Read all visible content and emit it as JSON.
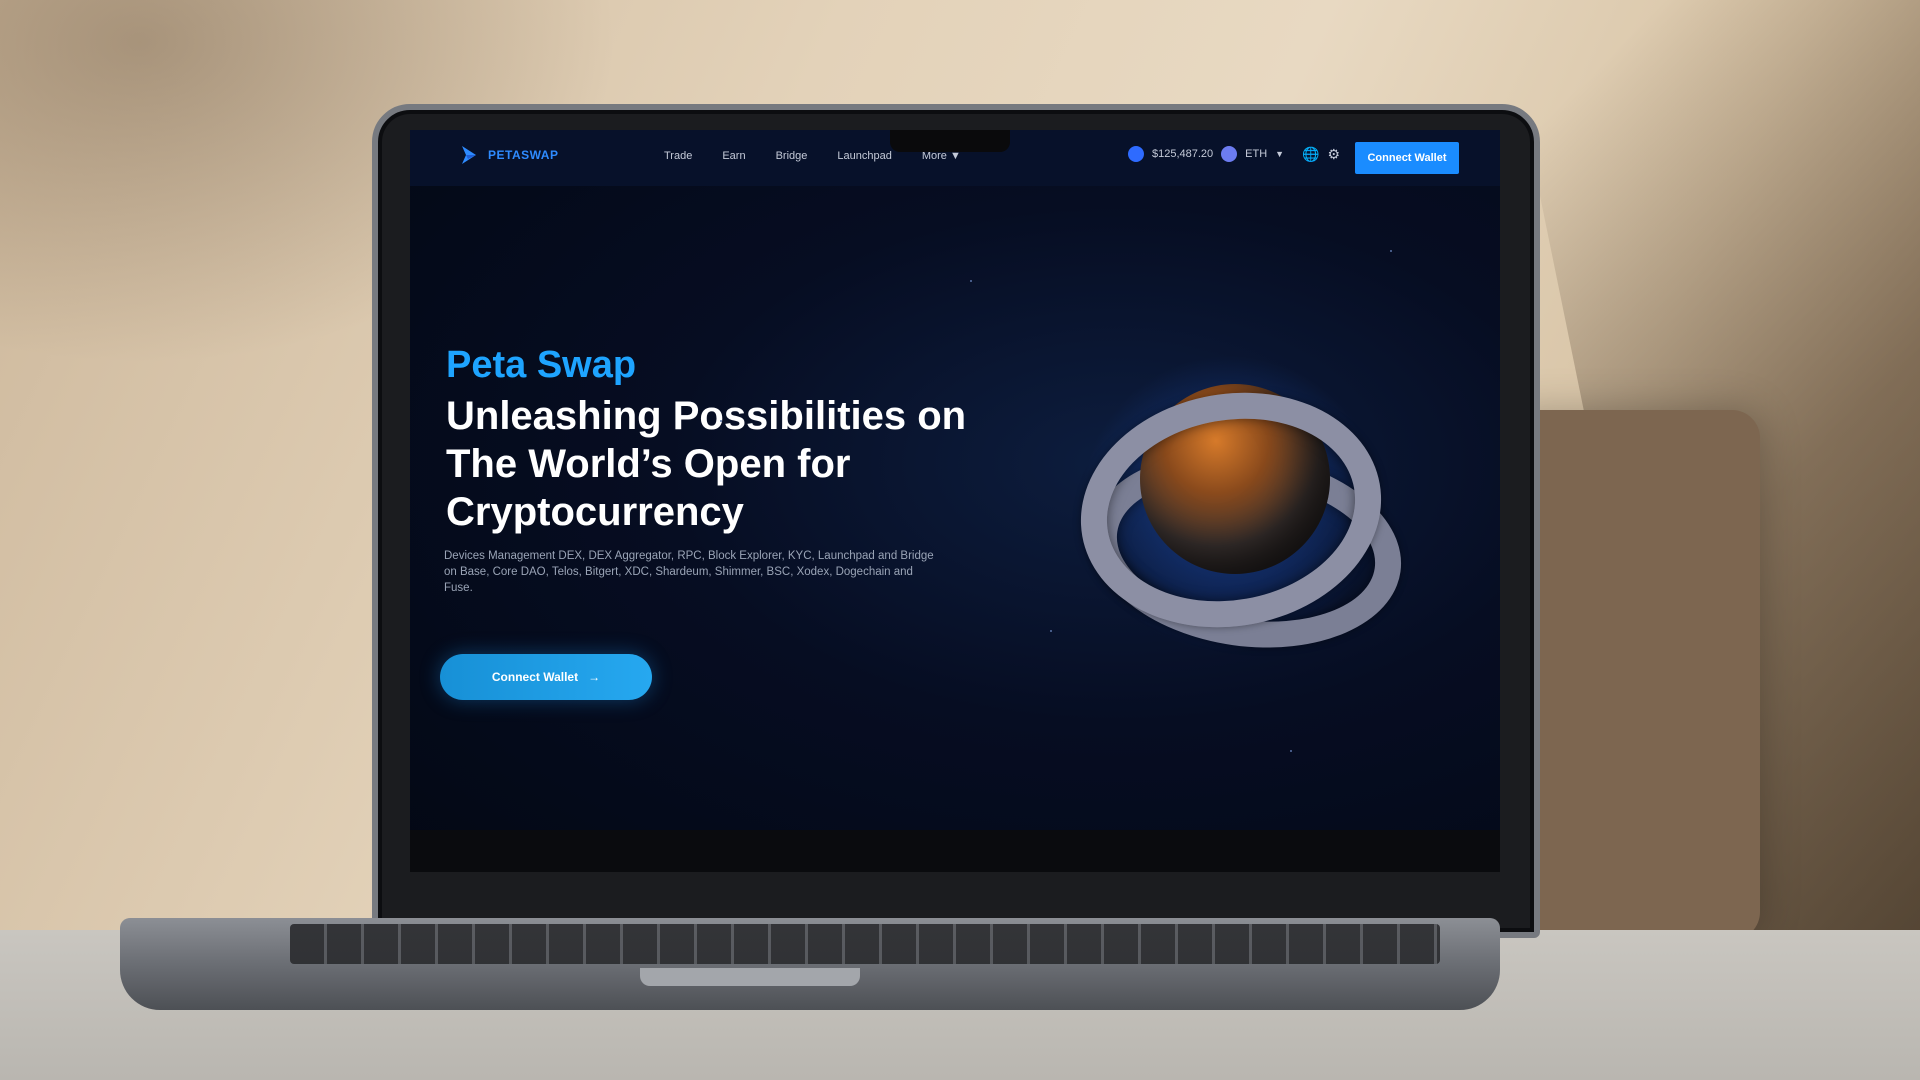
{
  "nav": {
    "brand": "PETASWAP",
    "menu": [
      "Trade",
      "Earn",
      "Bridge",
      "Launchpad",
      "More"
    ],
    "balance": "$125,487.20",
    "network": "ETH",
    "connect_label": "Connect Wallet"
  },
  "hero": {
    "brand": "Peta Swap",
    "title": "Unleashing Possibilities on The World’s Open for Cryptocurrency",
    "description": "Devices Management DEX, DEX Aggregator, RPC, Block Explorer, KYC, Launchpad and Bridge on Base, Core DAO, Telos, Bitgert, XDC, Shardeum, Shimmer, BSC, Xodex, Dogechain and Fuse.",
    "cta_label": "Connect Wallet"
  },
  "colors": {
    "accent": "#1a8cff",
    "brand_blue": "#1ea4ff",
    "screen_bg": "#060d22"
  }
}
